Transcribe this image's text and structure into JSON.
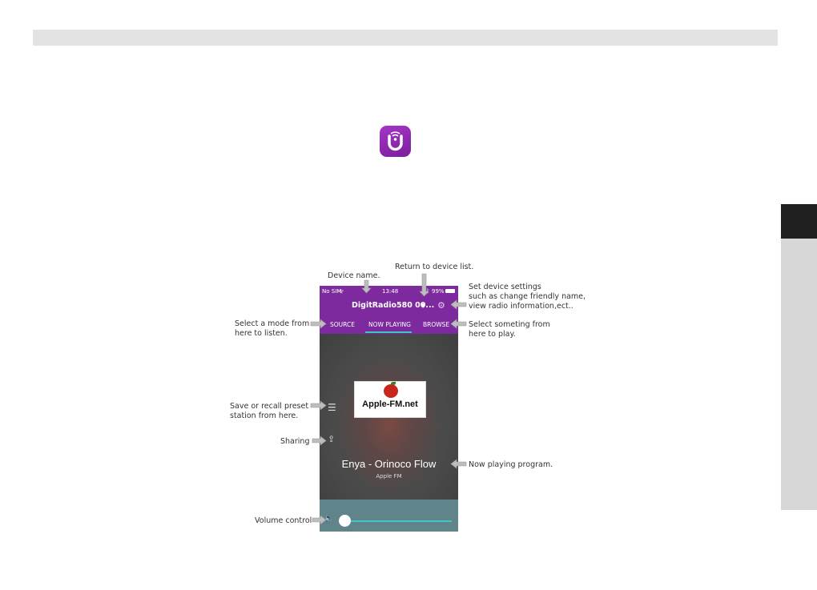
{
  "phone": {
    "status": {
      "carrier": "No SIM",
      "time": "13:48",
      "battery": "99%"
    },
    "device_name": "DigitRadio580 00...",
    "tabs": {
      "source": "SOURCE",
      "now_playing": "NOW PLAYING",
      "browse": "BROWSE"
    },
    "station_logo_text": "Apple-FM.net",
    "track_title": "Enya - Orinoco Flow",
    "track_station": "Apple FM",
    "volume_level": 0.0
  },
  "annotations": {
    "device_name": "Device name.",
    "return": "Return to device list.",
    "settings_1": "Set device settings",
    "settings_2": "such as change friendly name,",
    "settings_3": "view radio information,ect..",
    "mode_1": "Select a mode from",
    "mode_2": "here to listen.",
    "browse_1": "Select someting from",
    "browse_2": "here to play.",
    "preset_1": "Save or recall preset",
    "preset_2": "station from here.",
    "sharing": "Sharing",
    "now_playing": "Now playing program.",
    "volume": "Volume control"
  },
  "colors": {
    "header": "#7d2a9f",
    "accent": "#3fc8c4",
    "volume_bg": "#5f858b"
  }
}
